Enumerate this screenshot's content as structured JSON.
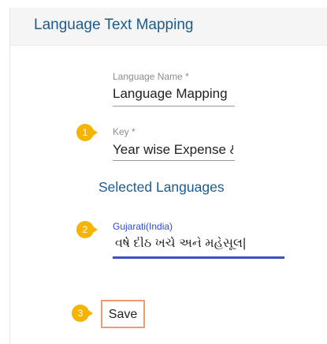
{
  "header": {
    "title": "Language Text Mapping"
  },
  "fields": {
    "language_name": {
      "label": "Language Name *",
      "value": "Language Mapping"
    },
    "key": {
      "label": "Key *",
      "value": "Year wise Expense &"
    }
  },
  "selected_languages": {
    "title": "Selected Languages",
    "items": [
      {
        "label": "Gujarati(India)",
        "value": "વર્ષ દીઠ ખર્ચ અને મહેસૂલ|"
      }
    ]
  },
  "save_button": {
    "label": "Save"
  },
  "step_badges": [
    "1",
    "2",
    "3"
  ],
  "colors": {
    "accent_blue": "#1e5b8c",
    "gujarati_label": "#2a4bd1",
    "active_underline": "#3d4fb8",
    "badge": "#f4b400",
    "save_border": "#f39a73"
  }
}
